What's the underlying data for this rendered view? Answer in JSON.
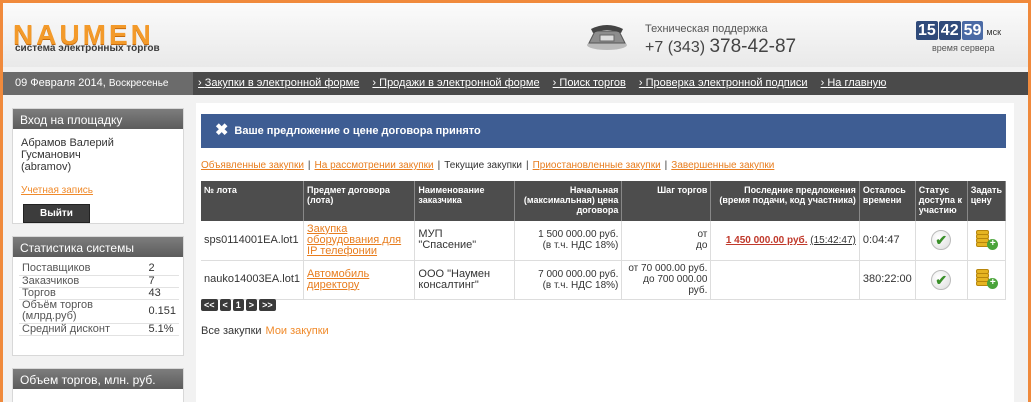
{
  "header": {
    "logo_text": "NAUMEN",
    "logo_subtitle": "система электронных торгов",
    "support_label": "Техническая поддержка",
    "support_phone_prefix": "+7 (343) ",
    "support_phone_main": "378-42-87",
    "clock": {
      "hours": "15",
      "minutes": "42",
      "seconds": "59",
      "tz": "мск",
      "caption": "время сервера"
    }
  },
  "navbar": {
    "date": "09 Февраля 2014,",
    "weekday": "Воскресенье",
    "links": [
      "Закупки в электронной форме",
      "Продажи в электронной форме",
      "Поиск торгов",
      "Проверка электронной подписи",
      "На главную"
    ]
  },
  "login": {
    "title": "Вход на площадку",
    "user_name": "Абрамов Валерий Гусманович",
    "user_login": "(abramov)",
    "account_link": "Учетная запись",
    "logout_button": "Выйти"
  },
  "stats": {
    "title": "Статистика системы",
    "rows": [
      {
        "label": "Поставщиков",
        "value": "2"
      },
      {
        "label": "Заказчиков",
        "value": "7"
      },
      {
        "label": "Торгов",
        "value": "43"
      },
      {
        "label": "Объём торгов (млрд.руб)",
        "value": "0.151"
      },
      {
        "label": "Средний дисконт",
        "value": "5.1%"
      }
    ]
  },
  "volume_panel": {
    "title": "Объем торгов, млн. руб."
  },
  "banner": {
    "icon": "close-icon",
    "text": "Ваше предложение о цене договора принято"
  },
  "tabs": [
    {
      "label": "Объявленные закупки",
      "current": false
    },
    {
      "label": "На рассмотрении закупки",
      "current": false
    },
    {
      "label": "Текущие закупки",
      "current": true
    },
    {
      "label": "Приостановленные закупки",
      "current": false
    },
    {
      "label": "Завершенные закупки",
      "current": false
    }
  ],
  "table": {
    "headers": [
      "№ лота",
      "Предмет договора (лота)",
      "Наименование заказчика",
      "Начальная (максимальная) цена договора",
      "Шаг торгов",
      "Последние предложения (время подачи, код участника)",
      "Осталось времени",
      "Статус доступа к участию",
      "Задать цену"
    ],
    "rows": [
      {
        "lot": "sps0114001EA.lot1",
        "subject": "Закупка оборудования для IP телефонии",
        "customer_line1": "МУП",
        "customer_line2": "\"Спасение\"",
        "price_line1": "1 500 000.00 руб.",
        "price_line2": "(в т.ч. НДС 18%)",
        "step_line1": "от",
        "step_line2": "до",
        "last_price": "1 450 000.00 руб.",
        "last_time": "(15:42:47)",
        "remaining": "0:04:47"
      },
      {
        "lot": "nauko14003EA.lot1",
        "subject": "Автомобиль директору",
        "customer_line1": "ООО \"Наумен",
        "customer_line2": "консалтинг\"",
        "price_line1": "7 000 000.00 руб.",
        "price_line2": "(в т.ч. НДС 18%)",
        "step_line1": "от 70 000.00 руб.",
        "step_line2": "до 700 000.00 руб.",
        "last_price": "",
        "last_time": "",
        "remaining": "380:22:00"
      }
    ]
  },
  "pager": [
    "<<",
    "<",
    "1",
    ">",
    ">>"
  ],
  "footer_links": {
    "all_label": "Все закупки",
    "mine_link": "Мои закупки"
  }
}
